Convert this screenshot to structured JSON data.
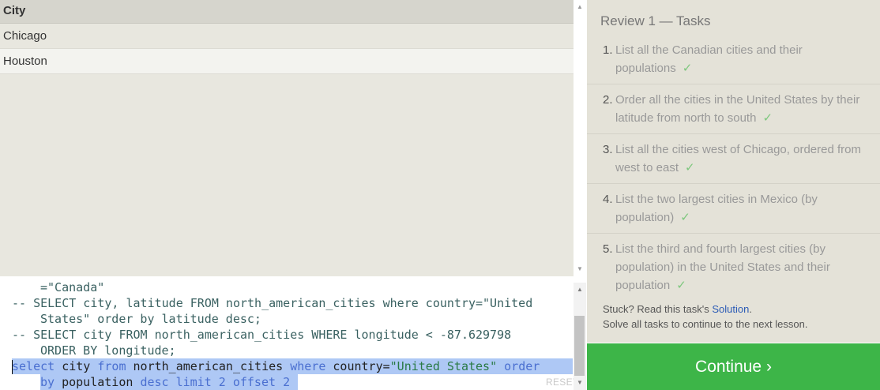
{
  "results": {
    "column": "City",
    "rows": [
      "Chicago",
      "Houston"
    ]
  },
  "editor": {
    "lines": [
      "=\"Canada\"",
      "-- SELECT city, latitude FROM north_american_cities where country=\"United",
      "States\" order by latitude desc;",
      "-- SELECT city FROM north_american_cities WHERE longitude < -87.629798",
      "ORDER BY longitude;"
    ],
    "current_query": {
      "l1": [
        "select",
        " city ",
        "from",
        " north_american_cities ",
        "where",
        " country=",
        "\"United States\"",
        " order"
      ],
      "l2": [
        "by",
        " population ",
        "desc",
        " limit ",
        "2",
        " offset ",
        "2"
      ]
    },
    "reset_label": "RESET"
  },
  "tasks": {
    "title": "Review 1 — Tasks",
    "items": [
      {
        "num": "1.",
        "text": "List all the Canadian cities and their populations",
        "check": "✓"
      },
      {
        "num": "2.",
        "text": "Order all the cities in the United States by their latitude from north to south",
        "check": "✓"
      },
      {
        "num": "3.",
        "text": "List all the cities west of Chicago, ordered from west to east",
        "check": "✓"
      },
      {
        "num": "4.",
        "text": "List the two largest cities in Mexico (by population)",
        "check": "✓"
      },
      {
        "num": "5.",
        "text": "List the third and fourth largest cities (by population) in the United States and their population",
        "check": "✓"
      }
    ],
    "help_prefix": "Stuck? Read this task's ",
    "help_link": "Solution",
    "help_suffix": ".",
    "help_line2": "Solve all tasks to continue to the next lesson."
  },
  "continue_label": "Continue ›",
  "colors": {
    "continue_bg": "#3db548",
    "check": "#7dc77d",
    "link": "#2b5bb5"
  }
}
